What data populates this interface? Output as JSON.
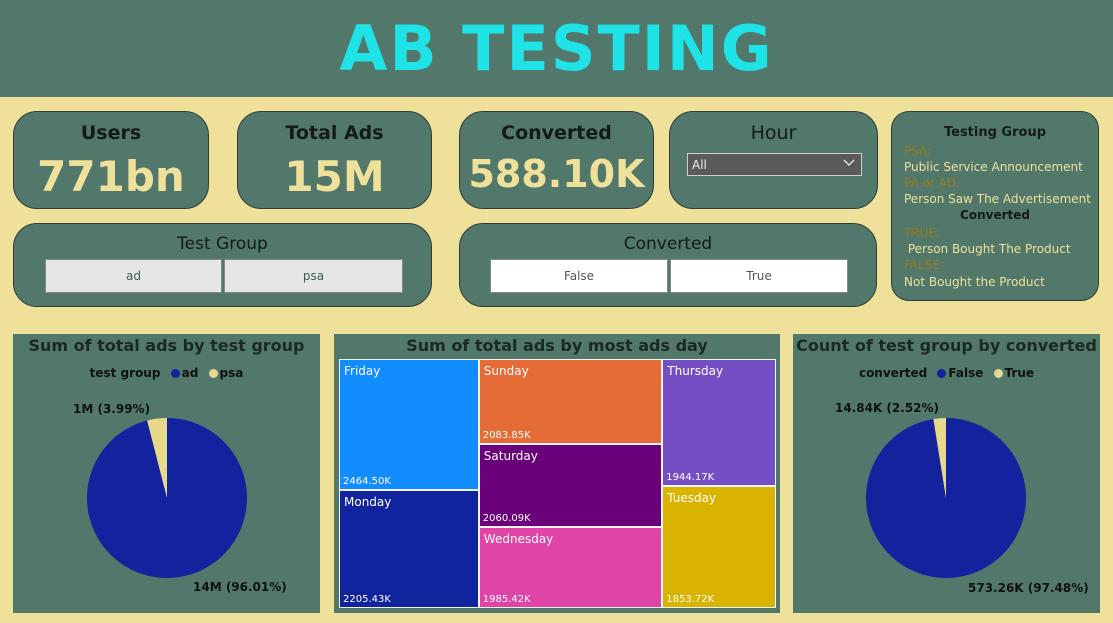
{
  "header": {
    "title": "AB TESTING"
  },
  "kpis": {
    "users": {
      "label": "Users",
      "value": "771bn"
    },
    "total_ads": {
      "label": "Total Ads",
      "value": "15M"
    },
    "converted": {
      "label": "Converted",
      "value": "588.10K"
    }
  },
  "hour": {
    "label": "Hour",
    "selected": "All"
  },
  "test_group_slicer": {
    "title": "Test Group",
    "options": [
      "ad",
      "psa"
    ]
  },
  "converted_slicer": {
    "title": "Converted",
    "options": [
      "False",
      "True"
    ]
  },
  "testing_group_legend": {
    "title": "Testing Group",
    "psa_term": "PSA:",
    "psa_def": "Public Service Announcement",
    "pa_term": "PA or AD:",
    "pa_def": "Person Saw The Advertisement",
    "converted_heading": "Converted",
    "true_term": "TRUE:",
    "true_def": " Person Bought The Product",
    "false_term": "FALSE:",
    "false_def": "Not Bought the Product"
  },
  "colors": {
    "header_bg": "#51786b",
    "page_bg": "#efe09a",
    "title_cyan": "#1fe3e6",
    "pie_blue": "#13239e",
    "pie_cream": "#e8d88c"
  },
  "chart_data": [
    {
      "type": "pie",
      "title": "Sum of total ads by test group",
      "legend_title": "test group",
      "legend": [
        "ad",
        "psa"
      ],
      "slices": [
        {
          "name": "ad",
          "value": 14,
          "unit": "M",
          "percent": 96.01,
          "label": "14M (96.01%)",
          "color": "#13239e"
        },
        {
          "name": "psa",
          "value": 1,
          "unit": "M",
          "percent": 3.99,
          "label": "1M (3.99%)",
          "color": "#e8d88c"
        }
      ]
    },
    {
      "type": "treemap",
      "title": "Sum of total ads by most ads day",
      "items": [
        {
          "name": "Friday",
          "value": 2464.5,
          "label": "2464.50K",
          "color": "#118dff"
        },
        {
          "name": "Monday",
          "value": 2205.43,
          "label": "2205.43K",
          "color": "#12239e"
        },
        {
          "name": "Sunday",
          "value": 2083.85,
          "label": "2083.85K",
          "color": "#e66c37"
        },
        {
          "name": "Saturday",
          "value": 2060.09,
          "label": "2060.09K",
          "color": "#6b007b"
        },
        {
          "name": "Wednesday",
          "value": 1985.42,
          "label": "1985.42K",
          "color": "#e044a7"
        },
        {
          "name": "Thursday",
          "value": 1944.17,
          "label": "1944.17K",
          "color": "#744ec2"
        },
        {
          "name": "Tuesday",
          "value": 1853.72,
          "label": "1853.72K",
          "color": "#d9b300"
        }
      ]
    },
    {
      "type": "pie",
      "title": "Count of test group by converted",
      "legend_title": "converted",
      "legend": [
        "False",
        "True"
      ],
      "slices": [
        {
          "name": "False",
          "value": 573.26,
          "unit": "K",
          "percent": 97.48,
          "label": "573.26K (97.48%)",
          "color": "#13239e"
        },
        {
          "name": "True",
          "value": 14.84,
          "unit": "K",
          "percent": 2.52,
          "label": "14.84K (2.52%)",
          "color": "#e8d88c"
        }
      ]
    }
  ]
}
